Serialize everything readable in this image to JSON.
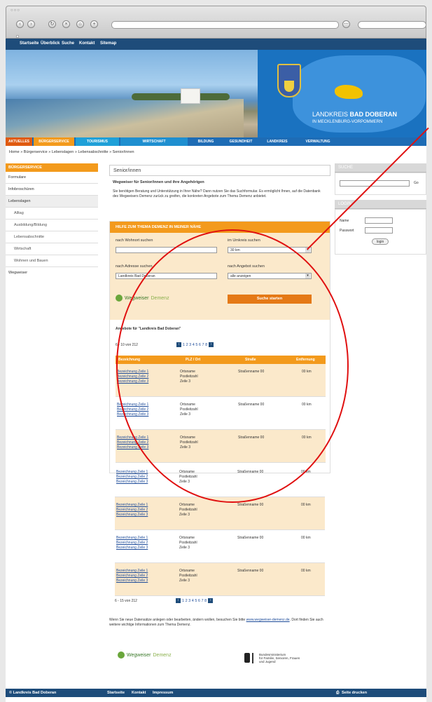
{
  "browser": {
    "window_dots": "○○○"
  },
  "topnav": [
    "Startseite",
    "Überblick",
    "Suche",
    "Kontakt",
    "Sitemap"
  ],
  "banner": {
    "brand_prefix": "LANDKREIS",
    "brand_name": "BAD DOBERAN",
    "brand_sub": "IN MECKLENBURG-VORPOMMERN"
  },
  "mainnav": [
    "AKTUELLES",
    "BÜRGERSERVICE",
    "TOURISMUS",
    "WIRTSCHAFT",
    "BILDUNG",
    "GESUNDHEIT",
    "LANDKREIS",
    "VERWALTUNG"
  ],
  "breadcrumb": "Home » Bürgerservice » Lebenslagen » Lebensabschnitte » Senior/innen",
  "leftnav": {
    "header": "BÜRGERSERVICE",
    "items": [
      "Formulare",
      "Infobroschüren",
      "Lebenslagen",
      "Alltag",
      "Ausbildung/Bildung",
      "Lebensabschnitte",
      "Wirtschaft",
      "Wohnen und Bauen",
      "Wegweiser"
    ]
  },
  "content": {
    "title": "Senior/innen",
    "intro_heading": "Wegweiser für Senior/innen und ihre Angehörigen",
    "intro_text": "Sie benötigen Beratung und Unterstützung in Ihrer Nähe? Dann nutzen Sie das Suchformular. Es ermöglicht Ihnen, auf die Datenbank des Wegweisers Demenz zurück zu greifen, die konkreten Angebote zum Thema Demenz anbietet."
  },
  "search": {
    "header": "HILFE ZUM THEMA DEMENZ IN MEINER NÄHE",
    "label_location": "nach Wohnort suchen",
    "label_radius": "im Umkreis suchen",
    "radius_value": "30 km",
    "label_address": "nach Adresse suchen",
    "address_value": "Landkreis Bad Doberan",
    "label_offer": "nach Angebot suchen",
    "offer_value": "alle anzeigen",
    "logo_w": "Wegweiser",
    "logo_d": "Demenz",
    "submit": "Suche starten"
  },
  "results": {
    "title": "Angebote für \"Landkreis Bad Doberan\"",
    "count_top": "6 - 10 von 212",
    "count_bottom": "6 - 15 von 212",
    "pager": "1 2 3 4 5 6 7 8",
    "columns": [
      "Bezeichnung",
      "PLZ / Ort",
      "Straße",
      "Entfernung"
    ],
    "rows": [
      {
        "links": [
          "Bezeichnung Zeile 1",
          "Bezeichnung Zeile 2",
          "Bezeichnung Zeile 3"
        ],
        "addr": [
          "Ortsname",
          "Postleitzahl",
          "Zeile 3"
        ],
        "street": "Straßenname 00",
        "dist": "00 km"
      },
      {
        "links": [
          "Bezeichnung Zeile 1",
          "Bezeichnung Zeile 2",
          "Bezeichnung Zeile 3"
        ],
        "addr": [
          "Ortsname",
          "Postleitzahl",
          "Zeile 3"
        ],
        "street": "Straßenname 00",
        "dist": "00 km"
      },
      {
        "links": [
          "Bezeichnung Zeile 1",
          "Bezeichnung Zeile 2",
          "Bezeichnung Zeile 3"
        ],
        "addr": [
          "Ortsname",
          "Postleitzahl",
          "Zeile 3"
        ],
        "street": "Straßenname 00",
        "dist": "00 km"
      },
      {
        "links": [
          "Bezeichnung Zeile 1",
          "Bezeichnung Zeile 2",
          "Bezeichnung Zeile 3"
        ],
        "addr": [
          "Ortsname",
          "Postleitzahl",
          "Zeile 3"
        ],
        "street": "Straßenname 00",
        "dist": "00 km"
      },
      {
        "links": [
          "Bezeichnung Zeile 1",
          "Bezeichnung Zeile 2",
          "Bezeichnung Zeile 3"
        ],
        "addr": [
          "Ortsname",
          "Postleitzahl",
          "Zeile 3"
        ],
        "street": "Straßenname 00",
        "dist": "00 km"
      },
      {
        "links": [
          "Bezeichnung Zeile 1",
          "Bezeichnung Zeile 2",
          "Bezeichnung Zeile 3"
        ],
        "addr": [
          "Ortsname",
          "Postleitzahl",
          "Zeile 3"
        ],
        "street": "Straßenname 00",
        "dist": "00 km"
      },
      {
        "links": [
          "Bezeichnung Zeile 1",
          "Bezeichnung Zeile 2",
          "Bezeichnung Zeile 3"
        ],
        "addr": [
          "Ortsname",
          "Postleitzahl",
          "Zeile 3"
        ],
        "street": "Straßenname 00",
        "dist": "00 km"
      }
    ]
  },
  "footer_note": {
    "text": "Wenn Sie neue Datensätze anlegen oder bearbeiten, ändern wollen, besuchen Sie bitte",
    "link": "www.wegweiser-demenz.de",
    "text2": ". Dort finden Sie auch weitere wichtige Informationen zum Thema Demenz.",
    "ministry": [
      "Bundesministerium",
      "für Familie, Senioren, Frauen",
      "und Jugend"
    ]
  },
  "sidebar": {
    "search_header": "SUCHE",
    "search_go": "Go",
    "login_header": "LOGIN",
    "name_label": "Name",
    "password_label": "Passwort",
    "login_button": "login"
  },
  "footer": {
    "copyright": "© Landkreis Bad Doberan",
    "links": [
      "Startseite",
      "Kontakt",
      "Impressum"
    ],
    "print": "Seite drucken"
  },
  "colors": {
    "navy": "#1e4c7a",
    "orange": "#f39a1c",
    "blue": "#1e6cb5",
    "annotation_red": "#e01010"
  }
}
